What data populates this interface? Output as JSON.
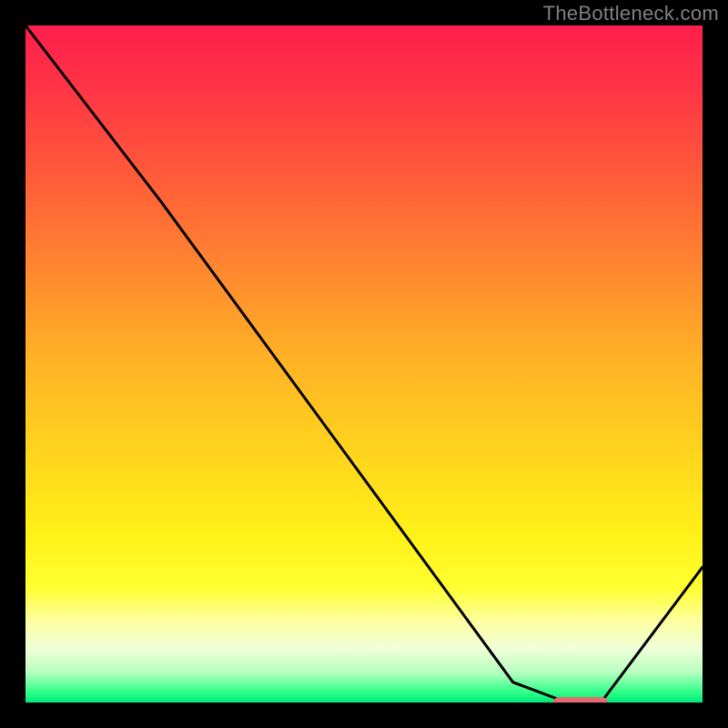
{
  "watermark": "TheBottleneck.com",
  "palette": {
    "frame": "#000000",
    "curve_stroke": "#000000",
    "marker_fill": "#e46a6f"
  },
  "gradient_stops": [
    {
      "offset": 0.0,
      "color": "#ff1e4c"
    },
    {
      "offset": 0.1,
      "color": "#ff3645"
    },
    {
      "offset": 0.22,
      "color": "#ff5a3a"
    },
    {
      "offset": 0.35,
      "color": "#ff8430"
    },
    {
      "offset": 0.48,
      "color": "#ffae26"
    },
    {
      "offset": 0.62,
      "color": "#ffd21e"
    },
    {
      "offset": 0.75,
      "color": "#fff018"
    },
    {
      "offset": 0.83,
      "color": "#ffff30"
    },
    {
      "offset": 0.88,
      "color": "#fdffa0"
    },
    {
      "offset": 0.92,
      "color": "#f0ffd8"
    },
    {
      "offset": 0.955,
      "color": "#b8ffc0"
    },
    {
      "offset": 0.985,
      "color": "#2eff88"
    },
    {
      "offset": 1.0,
      "color": "#00e87a"
    }
  ],
  "chart_data": {
    "type": "line",
    "title": "",
    "xlabel": "",
    "ylabel": "",
    "xlim": [
      0,
      100
    ],
    "ylim": [
      0,
      100
    ],
    "grid": false,
    "legend": false,
    "series": [
      {
        "name": "bottleneck-curve",
        "x": [
          0,
          20,
          72,
          80,
          85,
          100
        ],
        "y": [
          100,
          74,
          3,
          0,
          0,
          20
        ]
      }
    ],
    "marker": {
      "name": "optimal-segment",
      "x_start": 78,
      "x_end": 86,
      "y": 0,
      "color": "#e46a6f"
    },
    "notes": "x/y are percentages of the inner plot area (0–100). y=0 is bottom, y=100 is top. Curve is piecewise-linear as drawn; marker indicates the flat bottom segment."
  }
}
